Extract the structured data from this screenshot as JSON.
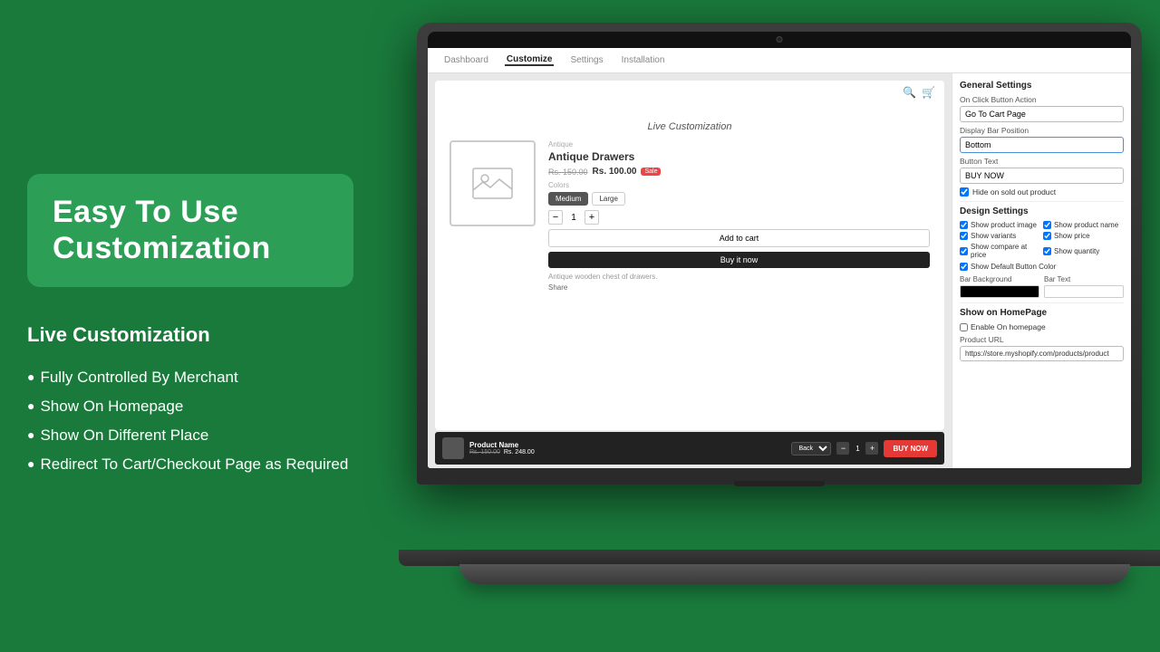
{
  "background_color": "#1a7a3c",
  "title_badge": {
    "text": "Easy To Use Customization"
  },
  "subtitle": "Live Customization",
  "features": [
    "Fully Controlled By Merchant",
    "Show On Homepage",
    "Show On Different Place",
    "Redirect To Cart/Checkout Page as Required"
  ],
  "nav": {
    "items": [
      {
        "label": "Dashboard",
        "active": false
      },
      {
        "label": "Customize",
        "active": true
      },
      {
        "label": "Settings",
        "active": false
      },
      {
        "label": "Installation",
        "active": false
      }
    ]
  },
  "product": {
    "name": "Antique Drawers",
    "price_old": "Rs. 150.00",
    "price_new": "Rs. 100.00",
    "sale_badge": "Sale",
    "sizes": [
      "Medium",
      "Large"
    ],
    "active_size": "Medium",
    "qty": 1,
    "description": "Antique wooden chest of drawers.",
    "add_to_cart": "Add to cart",
    "buy_now": "Buy it now",
    "share": "Share"
  },
  "live_label": "Live Customization",
  "bottom_bar": {
    "product_name": "Product Name",
    "price_old": "Rs. 150.00",
    "price_new": "Rs. 248.00",
    "variant_label": "Back",
    "qty": 1,
    "buy_now": "BUY NOW"
  },
  "settings": {
    "general_title": "General Settings",
    "on_click_label": "On Click Button Action",
    "on_click_value": "Go To Cart Page",
    "display_bar_label": "Display Bar Position",
    "display_bar_value": "Bottom",
    "button_text_label": "Button Text",
    "button_text_value": "BUY NOW",
    "hide_sold_out": "Hide on sold out product",
    "hide_sold_out_checked": true,
    "design_title": "Design Settings",
    "show_product_image": "Show product image",
    "show_product_name": "Show product name",
    "show_variants": "Show variants",
    "show_price": "Show price",
    "show_compare_price": "Show compare at price",
    "show_quantity": "Show quantity",
    "show_default_button": "Show Default Button Color",
    "bar_background_label": "Bar Background",
    "bar_text_label": "Bar Text",
    "show_on_homepage_title": "Show on HomePage",
    "enable_on_homepage": "Enable On homepage",
    "enable_checked": false,
    "product_url_label": "Product URL",
    "product_url_value": "https://store.myshopify.com/products/product"
  }
}
